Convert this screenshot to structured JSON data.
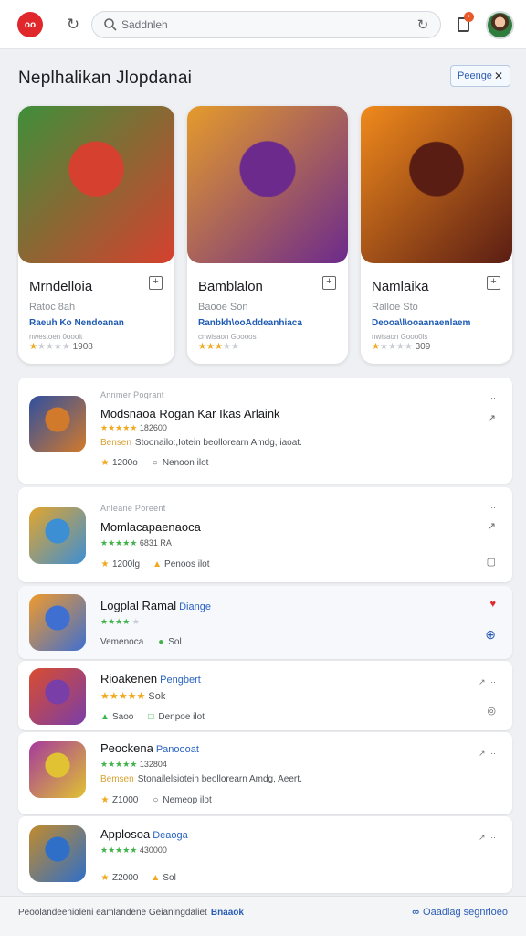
{
  "topbar": {
    "logo_text": "oo",
    "search_placeholder": "Saddnleh"
  },
  "section": {
    "title": "Neplhalikan Jlopdanai",
    "button_label": "Peenge",
    "button_close": "✕"
  },
  "featured": [
    {
      "name": "Mrndelloia",
      "sub": "Ratoc 8ah",
      "dev": "Raeuh Ko Nendoanan",
      "meta": "nwestoen 0ooolt",
      "rating_text": "1908",
      "stars_filled": 1,
      "color_a": "#3f8f3a",
      "color_b": "#d6402e"
    },
    {
      "name": "Bamblalon",
      "sub": "Baooe Son",
      "dev": "Ranbkh\\ooAddeanhiaca",
      "meta": "cnwisaon Goooos",
      "rating_text": "",
      "stars_filled": 3,
      "color_a": "#e59b2b",
      "color_b": "#6c2a8c"
    },
    {
      "name": "Namlaika",
      "sub": "Ralloe Sto",
      "dev": "Deooa\\l\\ooaanaenlaem",
      "meta": "nwisaon Gooo0ls",
      "rating_text": "309",
      "stars_filled": 1,
      "color_a": "#f08a1c",
      "color_b": "#5a1d14"
    }
  ],
  "list": [
    {
      "kicker": "Annmer Pogrant",
      "title": "Modsnaoa Rogan Kar Ikas Arlaink",
      "tag": "",
      "rating": "182600",
      "desc_label": "Bensen",
      "desc": "Stoonailo:,Iotein beollorearn Amdg, iaoat.",
      "f1": "1200o",
      "f2": "Nenoon ilot",
      "color_a": "#d27a2b",
      "color_b": "#2f4fa0"
    },
    {
      "kicker": "Anleane Poreent",
      "title": "Momlacapaenaoca",
      "tag": "",
      "rating": "6831 RA",
      "desc_label": "",
      "desc": "",
      "f1": "1200lg",
      "f2": "Penoos ilot",
      "color_a": "#3d8fd4",
      "color_b": "#e3a52c"
    },
    {
      "kicker": "",
      "title": "Logplal Ramal",
      "tag": "Diange",
      "rating": "",
      "desc_label": "",
      "desc": "",
      "f1": "Vemenoca",
      "f2": "Sol",
      "color_a": "#3f6fd0",
      "color_b": "#f09a2c"
    },
    {
      "kicker": "",
      "title": "Rioakenen",
      "tag": "Pengbert",
      "rating": "Sok",
      "desc_label": "",
      "desc": "",
      "f1": "Saoo",
      "f2": "Denpoe ilot",
      "color_a": "#7a3ea8",
      "color_b": "#d94d2f"
    },
    {
      "kicker": "",
      "title": "Peockena",
      "tag": "Panoooat",
      "rating": "132804",
      "desc_label": "Bemsen",
      "desc": "Stonailelsiotein beollorearn Amdg, Aeert.",
      "f1": "Z1000",
      "f2": "Nemeop ilot",
      "color_a": "#e0c232",
      "color_b": "#a53a9c"
    },
    {
      "kicker": "",
      "title": "Applosoa",
      "tag": "Deaoga",
      "rating": "430000",
      "desc_label": "",
      "desc": "",
      "f1": "Z2000",
      "f2": "Sol",
      "color_a": "#2f6fc8",
      "color_b": "#c28b2c"
    }
  ],
  "bottombar": {
    "left_text": "Peoolandeenioleni eamlandene Geianingdaliet",
    "left_link": "Bnaaok",
    "right_text": "Oaadiag segnrioeo"
  },
  "colors": {
    "accent": "#2a5db5",
    "logo_red": "#e0282c",
    "star": "#f0a81c",
    "star_green": "#3fb24a"
  }
}
